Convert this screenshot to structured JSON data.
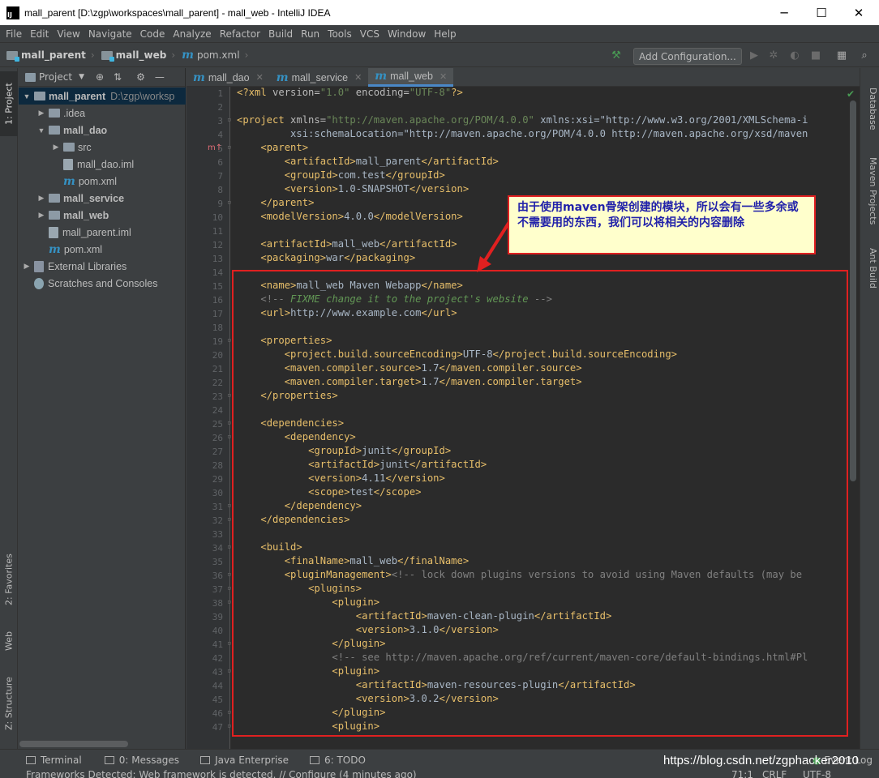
{
  "window": {
    "title": "mall_parent [D:\\zgp\\workspaces\\mall_parent] - mall_web - IntelliJ IDEA",
    "min": "─",
    "max": "☐",
    "close": "✕"
  },
  "menu": [
    "File",
    "Edit",
    "View",
    "Navigate",
    "Code",
    "Analyze",
    "Refactor",
    "Build",
    "Run",
    "Tools",
    "VCS",
    "Window",
    "Help"
  ],
  "breadcrumb": [
    "mall_parent",
    "mall_web",
    "pom.xml"
  ],
  "toolbar": {
    "add_config": "Add Configuration..."
  },
  "left_tabs": {
    "project": "1: Project",
    "favorites": "2: Favorites",
    "web": "Web",
    "structure": "Z: Structure"
  },
  "right_tabs": {
    "database": "Database",
    "maven": "Maven Projects",
    "ant": "Ant Build"
  },
  "project_panel": {
    "title": "Project",
    "tree": [
      {
        "label": "mall_parent",
        "path": "D:\\zgp\\worksp",
        "arrow": "▼",
        "indent": 0
      },
      {
        "label": ".idea",
        "arrow": "▶",
        "indent": 1
      },
      {
        "label": "mall_dao",
        "arrow": "▼",
        "indent": 1
      },
      {
        "label": "src",
        "arrow": "▶",
        "indent": 2
      },
      {
        "label": "mall_dao.iml",
        "arrow": "",
        "indent": 2
      },
      {
        "label": "pom.xml",
        "arrow": "",
        "indent": 2
      },
      {
        "label": "mall_service",
        "arrow": "▶",
        "indent": 1
      },
      {
        "label": "mall_web",
        "arrow": "▶",
        "indent": 1
      },
      {
        "label": "mall_parent.iml",
        "arrow": "",
        "indent": 1
      },
      {
        "label": "pom.xml",
        "arrow": "",
        "indent": 1
      },
      {
        "label": "External Libraries",
        "arrow": "▶",
        "indent": 0
      },
      {
        "label": "Scratches and Consoles",
        "arrow": "",
        "indent": 0
      }
    ]
  },
  "editor_tabs": [
    "mall_dao",
    "mall_service",
    "mall_web"
  ],
  "code": [
    "<?xml version=\"1.0\" encoding=\"UTF-8\"?>",
    "",
    "<project xmlns=\"http://maven.apache.org/POM/4.0.0\" xmlns:xsi=\"http://www.w3.org/2001/XMLSchema-i",
    "         xsi:schemaLocation=\"http://maven.apache.org/POM/4.0.0 http://maven.apache.org/xsd/maven",
    "    <parent>",
    "        <artifactId>mall_parent</artifactId>",
    "        <groupId>com.test</groupId>",
    "        <version>1.0-SNAPSHOT</version>",
    "    </parent>",
    "    <modelVersion>4.0.0</modelVersion>",
    "",
    "    <artifactId>mall_web</artifactId>",
    "    <packaging>war</packaging>",
    "",
    "    <name>mall_web Maven Webapp</name>",
    "    <!-- FIXME change it to the project's website -->",
    "    <url>http://www.example.com</url>",
    "",
    "    <properties>",
    "        <project.build.sourceEncoding>UTF-8</project.build.sourceEncoding>",
    "        <maven.compiler.source>1.7</maven.compiler.source>",
    "        <maven.compiler.target>1.7</maven.compiler.target>",
    "    </properties>",
    "",
    "    <dependencies>",
    "        <dependency>",
    "            <groupId>junit</groupId>",
    "            <artifactId>junit</artifactId>",
    "            <version>4.11</version>",
    "            <scope>test</scope>",
    "        </dependency>",
    "    </dependencies>",
    "",
    "    <build>",
    "        <finalName>mall_web</finalName>",
    "        <pluginManagement><!-- lock down plugins versions to avoid using Maven defaults (may be",
    "            <plugins>",
    "                <plugin>",
    "                    <artifactId>maven-clean-plugin</artifactId>",
    "                    <version>3.1.0</version>",
    "                </plugin>",
    "                <!-- see http://maven.apache.org/ref/current/maven-core/default-bindings.html#Pl",
    "                <plugin>",
    "                    <artifactId>maven-resources-plugin</artifactId>",
    "                    <version>3.0.2</version>",
    "                </plugin>",
    "                <plugin>"
  ],
  "callout": "由于使用maven骨架创建的模块，所以会有一些多余或不需要用的东西，我们可以将相关的内容删除",
  "bottom_tools": [
    "Terminal",
    "0: Messages",
    "Java Enterprise",
    "6: TODO",
    "Event Log"
  ],
  "status": {
    "message": "Frameworks Detected: Web framework is detected. // Configure (4 minutes ago)",
    "position": "71:1",
    "line_sep": "CRLF",
    "encoding": "UTF-8"
  },
  "watermark": "https://blog.csdn.net/zgphacker2010",
  "colors": {
    "accent": "#4a88c7",
    "callout_border": "#e02020",
    "callout_text": "#2222aa"
  }
}
